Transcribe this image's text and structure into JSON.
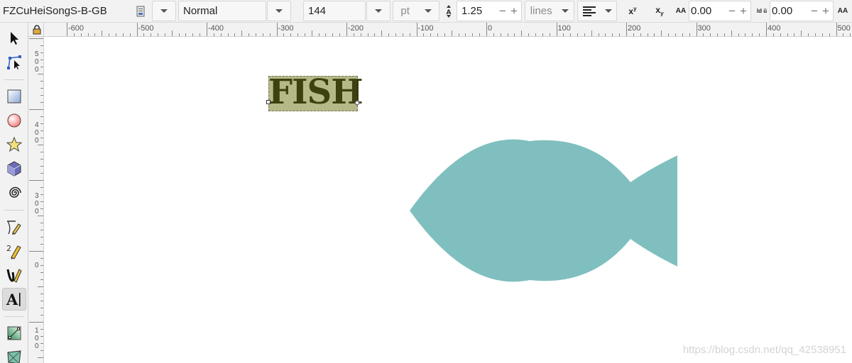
{
  "toolbar": {
    "font_family": "FZCuHeiSongS-B-GB",
    "font_style": "Normal",
    "font_size": "144",
    "font_unit": "pt",
    "line_height": "1.25",
    "line_unit": "lines",
    "letter_spacing": "0.00",
    "word_spacing": "0.00",
    "superscript_label": "x",
    "superscript_mark": "y",
    "subscript_label": "x",
    "subscript_mark": "y",
    "letter_spacing_icon_label": "AA",
    "word_spacing_icon_label": "ld ü",
    "plus": "+",
    "minus": "−"
  },
  "ruler": {
    "h_labels": [
      "-600",
      "-500",
      "-400",
      "-300",
      "-200",
      "-100",
      "0",
      "100",
      "200",
      "300",
      "400",
      "500"
    ]
  },
  "tools": [
    {
      "name": "selector-icon"
    },
    {
      "name": "node-editor-icon"
    },
    {
      "name": "rectangle-icon"
    },
    {
      "name": "ellipse-icon"
    },
    {
      "name": "star-icon"
    },
    {
      "name": "box-3d-icon"
    },
    {
      "name": "spiral-icon"
    },
    {
      "name": "bezier-pen-icon"
    },
    {
      "name": "pencil-icon"
    },
    {
      "name": "calligraphy-icon"
    },
    {
      "name": "text-tool-icon"
    },
    {
      "name": "gradient-icon"
    },
    {
      "name": "mesh-icon"
    }
  ],
  "canvas": {
    "text_object": "FISH",
    "fish_color": "#80bfbf",
    "text_bg_color": "#b6b987",
    "text_color": "#3d4010"
  },
  "watermark": "https://blog.csdn.net/qq_42538951"
}
